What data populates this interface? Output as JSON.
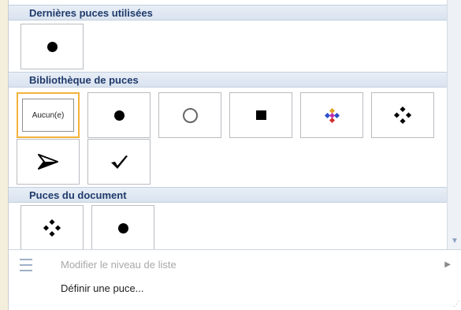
{
  "sections": {
    "recent": {
      "title": "Dernières puces utilisées"
    },
    "library": {
      "title": "Bibliothèque de puces",
      "none_label": "Aucun(e)"
    },
    "document": {
      "title": "Puces du document"
    }
  },
  "bullets": {
    "recent": [
      "filled-circle"
    ],
    "library": [
      "none",
      "filled-circle",
      "hollow-circle",
      "filled-square",
      "colored-four-diamond",
      "four-diamond",
      "arrowhead",
      "checkmark"
    ],
    "document": [
      "four-diamond",
      "filled-circle"
    ]
  },
  "menu": {
    "change_level": "Modifier le niveau de liste",
    "define_bullet": "Définir une puce..."
  },
  "colors": {
    "header_text": "#1f3a6b",
    "selected_border": "#f3b23a",
    "header_background": "#dde6f1"
  }
}
